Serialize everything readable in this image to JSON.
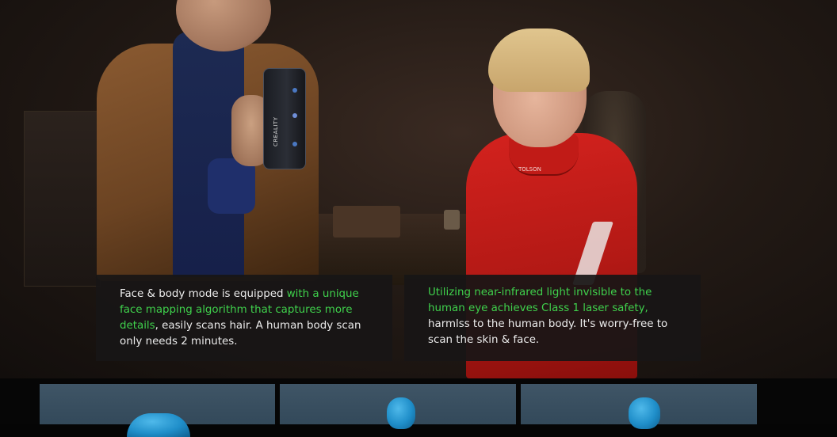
{
  "hero": {
    "scanner_brand": "CREALITY",
    "jacket_text": "TOLSON",
    "panel_left": {
      "text_1": "Face & body mode is equipped ",
      "highlight": "with a unique face mapping algorithm that captures more details",
      "text_2": ", easily scans hair. A human body scan only needs 2 minutes."
    },
    "panel_right": {
      "highlight": "Utilizing near-infrared light invisible to the human eye achieves Class 1 laser safety,",
      "text": " harmlss to the human body. It's worry-free to scan the skin & face."
    },
    "highlight_color": "#3fd14c"
  },
  "thumbnails": [
    {
      "icon": "head-scan-model-icon"
    },
    {
      "icon": "head-scan-model-icon"
    },
    {
      "icon": "head-scan-model-icon"
    }
  ]
}
